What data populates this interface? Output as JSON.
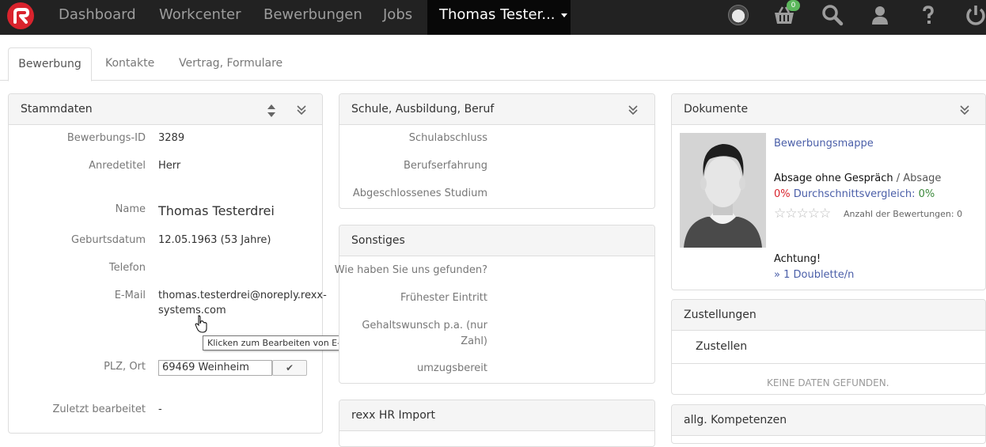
{
  "nav": {
    "items": [
      "Dashboard",
      "Workcenter",
      "Bewerbungen",
      "Jobs"
    ],
    "active": "Thomas Tester...",
    "cart_count": "0"
  },
  "tabs": [
    "Bewerbung",
    "Kontakte",
    "Vertrag, Formulare"
  ],
  "stammdaten": {
    "title": "Stammdaten",
    "labels": {
      "id": "Bewerbungs-ID",
      "anrede": "Anredetitel",
      "name": "Name",
      "geburt": "Geburtsdatum",
      "telefon": "Telefon",
      "email": "E-Mail",
      "plz": "PLZ, Ort",
      "zuletzt": "Zuletzt bearbeitet"
    },
    "values": {
      "id": "3289",
      "anrede": "Herr",
      "name": "Thomas Testerdrei",
      "geburt": "12.05.1963 (53 Jahre)",
      "email_line1": "thomas.testerdrei@noreply.rexx-",
      "email_line2": "systems.com",
      "plz": "69469 Weinheim",
      "zuletzt": "-"
    },
    "tooltip": "Klicken zum Bearbeiten von E-Mail"
  },
  "schule": {
    "title": "Schule, Ausbildung, Beruf",
    "labels": [
      "Schulabschluss",
      "Berufserfahrung",
      "Abgeschlossenes Studium"
    ]
  },
  "sonstiges": {
    "title": "Sonstiges",
    "labels": {
      "gefunden": "Wie haben Sie uns gefunden?",
      "eintritt": "Frühester Eintritt",
      "gehalt1": "Gehaltswunsch p.a. (nur",
      "gehalt2": "Zahl)",
      "umzug": "umzugsbereit"
    }
  },
  "rexx": {
    "title": "rexx HR Import"
  },
  "dokumente": {
    "title": "Dokumente",
    "mappe": "Bewerbungsmappe",
    "absage_bold": "Absage ohne Gespräch",
    "absage_rest": " / Absage",
    "percent": "0%",
    "vergleich": "Durchschnittsvergleich:",
    "vergleich_val": "0%",
    "bewertungen": "Anzahl der Bewertungen: 0",
    "achtung": "Achtung!",
    "doublette": "» 1 Doublette/n"
  },
  "zustellungen": {
    "title": "Zustellungen",
    "zustellen": "Zustellen",
    "empty": "KEINE DATEN GEFUNDEN."
  },
  "kompetenzen": {
    "title": "allg. Kompetenzen"
  },
  "colors": {
    "nav_bg": "#222222",
    "brand": "#d9232d",
    "link": "#4a5ea8",
    "badge": "#5cb85c",
    "percent_red": "#d9232d",
    "percent_green": "#3c8a3c"
  }
}
